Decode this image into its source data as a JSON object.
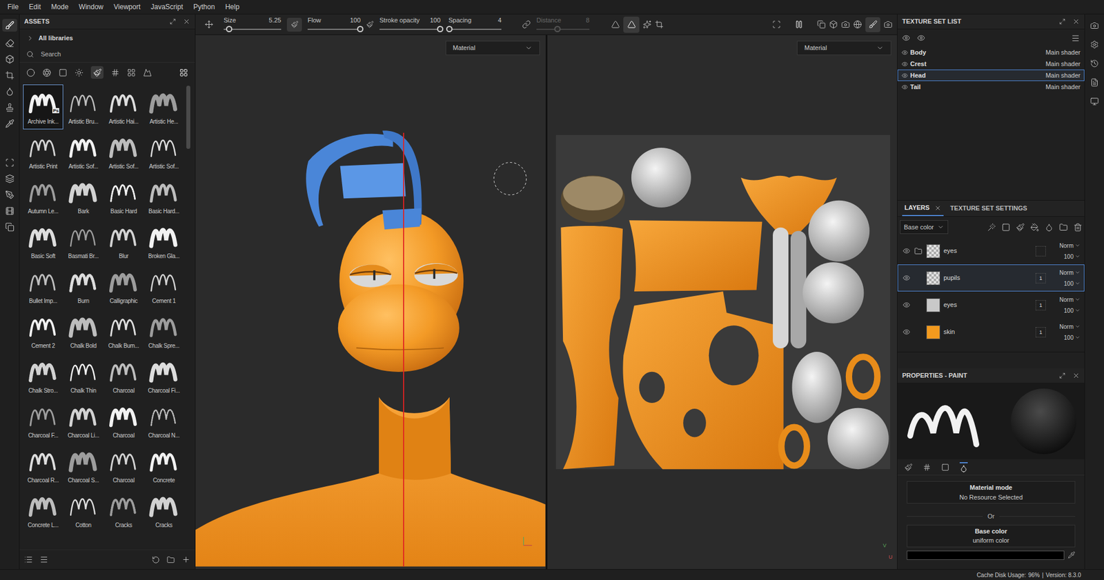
{
  "menu": [
    "File",
    "Edit",
    "Mode",
    "Window",
    "Viewport",
    "JavaScript",
    "Python",
    "Help"
  ],
  "tool_options": {
    "sliders": [
      {
        "label": "Size",
        "value": "5.25",
        "level": 0.1,
        "disabled": false
      },
      {
        "label": "Flow",
        "value": "100",
        "level": 1,
        "disabled": false
      },
      {
        "label": "Stroke opacity",
        "value": "100",
        "level": 1,
        "disabled": false
      },
      {
        "label": "Spacing",
        "value": "4",
        "level": 0.02,
        "disabled": false
      },
      {
        "label": "Distance",
        "value": "8",
        "level": 0.4,
        "disabled": true
      }
    ]
  },
  "viewports": [
    {
      "mode": "Material"
    },
    {
      "mode": "Material",
      "axes": [
        "V",
        "U"
      ]
    }
  ],
  "assets": {
    "title": "ASSETS",
    "library": "All libraries",
    "search_placeholder": "Search",
    "brushes": [
      {
        "label": "Archive Ink...",
        "selected": true,
        "badge": "Ps"
      },
      {
        "label": "Artistic Bru...",
        "selected": false
      },
      {
        "label": "Artistic Hai...",
        "selected": false
      },
      {
        "label": "Artistic He...",
        "selected": false
      },
      {
        "label": "Artistic Print",
        "selected": false
      },
      {
        "label": "Artistic Sof...",
        "selected": false
      },
      {
        "label": "Artistic Sof...",
        "selected": false
      },
      {
        "label": "Artistic Sof...",
        "selected": false
      },
      {
        "label": "Autumn Le...",
        "selected": false
      },
      {
        "label": "Bark",
        "selected": false
      },
      {
        "label": "Basic Hard",
        "selected": false
      },
      {
        "label": "Basic Hard...",
        "selected": false
      },
      {
        "label": "Basic Soft",
        "selected": false
      },
      {
        "label": "Basmati Br...",
        "selected": false
      },
      {
        "label": "Blur",
        "selected": false
      },
      {
        "label": "Broken Gla...",
        "selected": false
      },
      {
        "label": "Bullet Imp...",
        "selected": false
      },
      {
        "label": "Burn",
        "selected": false
      },
      {
        "label": "Calligraphic",
        "selected": false
      },
      {
        "label": "Cement 1",
        "selected": false
      },
      {
        "label": "Cement 2",
        "selected": false
      },
      {
        "label": "Chalk Bold",
        "selected": false
      },
      {
        "label": "Chalk Bum...",
        "selected": false
      },
      {
        "label": "Chalk Spre...",
        "selected": false
      },
      {
        "label": "Chalk Stro...",
        "selected": false
      },
      {
        "label": "Chalk Thin",
        "selected": false
      },
      {
        "label": "Charcoal",
        "selected": false
      },
      {
        "label": "Charcoal Fi...",
        "selected": false
      },
      {
        "label": "Charcoal F...",
        "selected": false
      },
      {
        "label": "Charcoal Li...",
        "selected": false
      },
      {
        "label": "Charcoal",
        "selected": false
      },
      {
        "label": "Charcoal N...",
        "selected": false
      },
      {
        "label": "Charcoal R...",
        "selected": false
      },
      {
        "label": "Charcoal S...",
        "selected": false
      },
      {
        "label": "Charcoal",
        "selected": false
      },
      {
        "label": "Concrete",
        "selected": false
      },
      {
        "label": "Concrete L...",
        "selected": false
      },
      {
        "label": "Cotton",
        "selected": false
      },
      {
        "label": "Cracks",
        "selected": false
      },
      {
        "label": "Cracks",
        "selected": false
      }
    ]
  },
  "texture_set_list": {
    "title": "TEXTURE SET LIST",
    "items": [
      {
        "name": "Body",
        "shader": "Main shader",
        "selected": false
      },
      {
        "name": "Crest",
        "shader": "Main shader",
        "selected": false
      },
      {
        "name": "Head",
        "shader": "Main shader",
        "selected": true
      },
      {
        "name": "Tail",
        "shader": "Main shader",
        "selected": false
      }
    ]
  },
  "layers": {
    "tabs": [
      {
        "label": "LAYERS",
        "selected": true
      },
      {
        "label": "TEXTURE SET SETTINGS",
        "selected": false
      }
    ],
    "channel": "Base color",
    "items": [
      {
        "name": "eyes",
        "folder": true,
        "thumb": "checker",
        "color": "#cfcfcf",
        "blend": "Norm",
        "opacity": "100",
        "selected": false
      },
      {
        "name": "pupils",
        "folder": false,
        "thumb": "checker",
        "color": "#cfcfcf",
        "blend": "Norm",
        "opacity": "100",
        "selected": true,
        "badge": "1"
      },
      {
        "name": "eyes",
        "folder": false,
        "thumb": "solid",
        "color": "#c9c9c9",
        "blend": "Norm",
        "opacity": "100",
        "selected": false,
        "badge": "1"
      },
      {
        "name": "skin",
        "folder": false,
        "thumb": "solid",
        "color": "#f39a1e",
        "blend": "Norm",
        "opacity": "100",
        "selected": false,
        "badge": "1"
      }
    ]
  },
  "properties": {
    "title": "PROPERTIES - PAINT",
    "material_mode": "Material mode",
    "material_value": "No Resource Selected",
    "or": "Or",
    "base_color": "Base color",
    "base_color_mode": "uniform color",
    "color": "#000000"
  },
  "status_bar": {
    "cache_label": "Cache Disk Usage:",
    "cache_value": "96%",
    "separator": "|",
    "version": "Version: 8.3.0"
  }
}
